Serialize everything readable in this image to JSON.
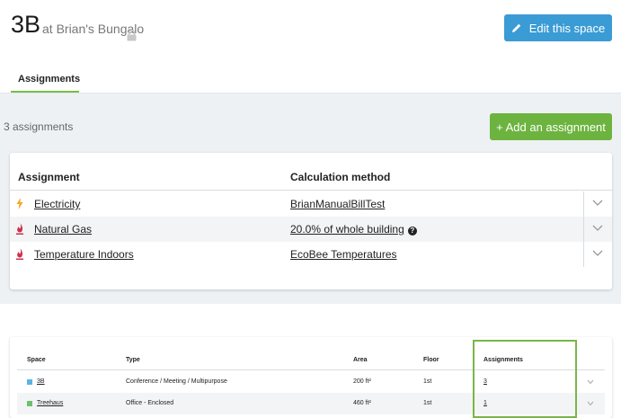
{
  "header": {
    "space_name": "3B",
    "at_label": "at Brian's Bungalo",
    "edit_button": "Edit this space",
    "tab": "Assignments"
  },
  "assignments": {
    "count_label": "3 assignments",
    "add_button": "+ Add an assignment",
    "columns": [
      "Assignment",
      "Calculation method"
    ],
    "rows": [
      {
        "name": "Electricity",
        "method": "BrianManualBillTest",
        "icon": "lightning-icon",
        "icon_color": "#f5a623"
      },
      {
        "name": "Natural Gas",
        "method": "20.0% of whole building",
        "icon": "flame-icon",
        "icon_color": "#d0304a"
      },
      {
        "name": "Temperature Indoors",
        "method": "EcoBee Temperatures",
        "icon": "flame-icon",
        "icon_color": "#d0304a"
      }
    ]
  },
  "spaces_table": {
    "columns": [
      "Space",
      "Type",
      "Area",
      "Floor",
      "Assignments"
    ],
    "rows": [
      {
        "space": "3B",
        "type": "Conference / Meeting / Multipurpose",
        "area": "200 ft²",
        "floor": "1st",
        "assignments": "3",
        "color": "#5ab4e5"
      },
      {
        "space": "Treehaus",
        "type": "Office - Enclosed",
        "area": "460 ft²",
        "floor": "1st",
        "assignments": "1",
        "color": "#6cc06a"
      }
    ]
  },
  "colors": {
    "edit_button": "#3a9bd5",
    "add_button": "#6db33f",
    "tab_underline": "#76c043",
    "highlight_box": "#7ab648"
  }
}
